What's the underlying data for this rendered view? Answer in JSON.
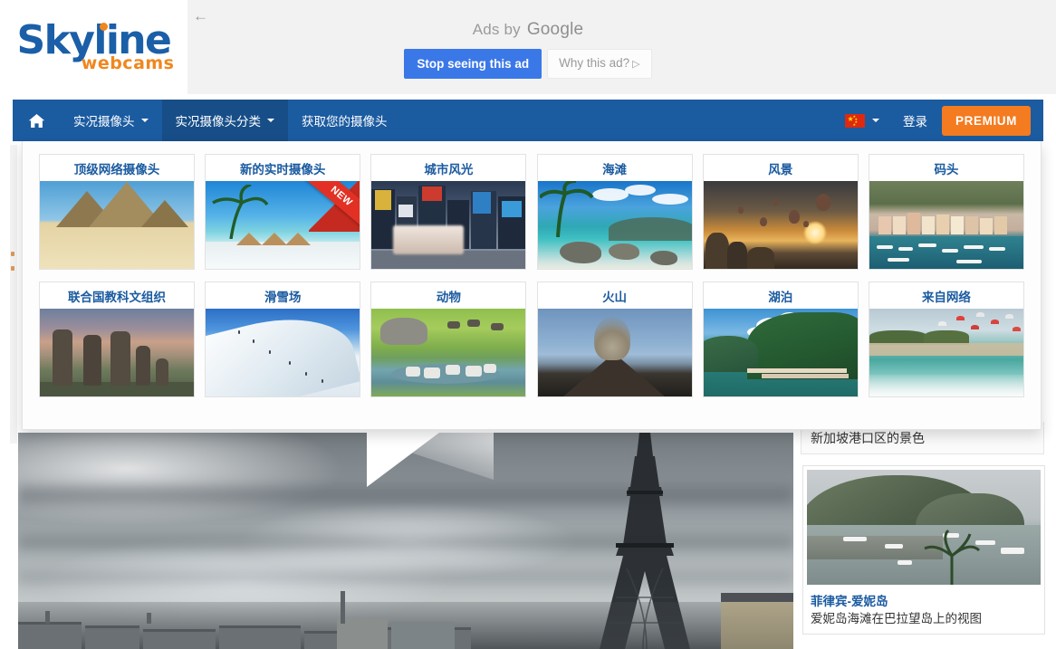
{
  "ad": {
    "back_icon": "back-arrow-icon",
    "label_prefix": "Ads by",
    "label_brand": "Google",
    "stop_button": "Stop seeing this ad",
    "why_button": "Why this ad?",
    "why_glyph": "▷",
    "accent_blue": "#3b78e7",
    "background": "#f2f2f2"
  },
  "logo": {
    "word": "Skyline",
    "sub": "webcams",
    "word_color": "#1a5fa8",
    "sub_color": "#f0871e"
  },
  "nav": {
    "background": "#1b5ba0",
    "active_background": "#174e88",
    "home_icon": "home-icon",
    "items": [
      {
        "label": "实况摄像头",
        "has_caret": true,
        "active": false
      },
      {
        "label": "实况摄像头分类",
        "has_caret": true,
        "active": true
      },
      {
        "label": "获取您的摄像头",
        "has_caret": false,
        "active": false
      }
    ],
    "language": {
      "icon": "china-flag-icon",
      "caret": true
    },
    "login_label": "登录",
    "premium_label": "PREMIUM",
    "premium_color": "#f47b20"
  },
  "mega_menu": {
    "rows": [
      [
        {
          "label": "顶级网络摄像头",
          "art": "pyramids",
          "badge": ""
        },
        {
          "label": "新的实时摄像头",
          "art": "beach-huts",
          "badge": "NEW"
        },
        {
          "label": "城市风光",
          "art": "city-street",
          "badge": ""
        },
        {
          "label": "海滩",
          "art": "tropical-beach",
          "badge": ""
        },
        {
          "label": "风景",
          "art": "cappadocia-balloons",
          "badge": ""
        },
        {
          "label": "码头",
          "art": "harbor",
          "badge": ""
        }
      ],
      [
        {
          "label": "联合国教科文组织",
          "art": "moai-statues",
          "badge": ""
        },
        {
          "label": "滑雪场",
          "art": "ski-slope",
          "badge": ""
        },
        {
          "label": "动物",
          "art": "safari-animals",
          "badge": ""
        },
        {
          "label": "火山",
          "art": "volcano",
          "badge": ""
        },
        {
          "label": "湖泊",
          "art": "lake-village",
          "badge": ""
        },
        {
          "label": "来自网络",
          "art": "kitesurfing",
          "badge": ""
        }
      ]
    ],
    "title_color": "#1b5ba0"
  },
  "player": {
    "scene": "eiffel-tower-overcast-webcam"
  },
  "sidebar": {
    "caption_above": "新加坡港口区的景色",
    "card": {
      "thumb": "el-nido-harbor-thumbnail",
      "title": "菲律宾-爱妮岛",
      "description": "爱妮岛海滩在巴拉望岛上的视图",
      "title_color": "#1b5ba0"
    }
  }
}
